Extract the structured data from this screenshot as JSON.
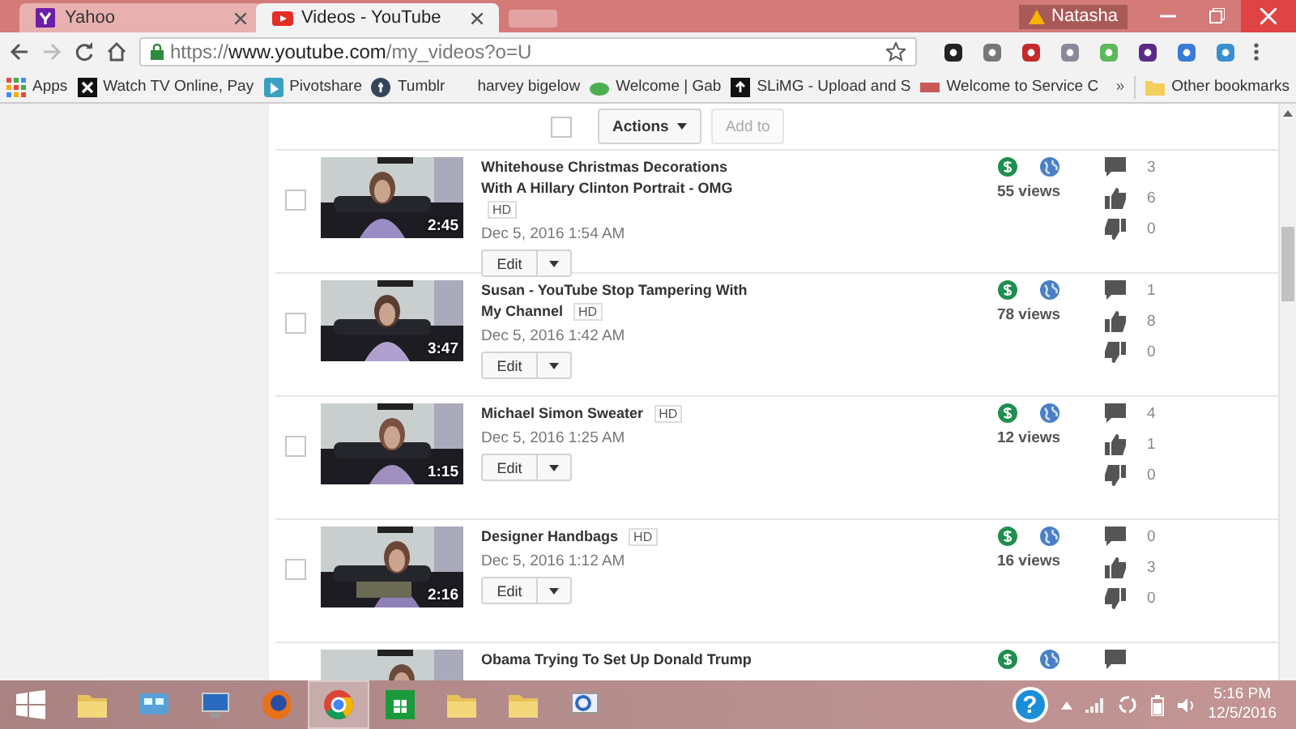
{
  "window": {
    "profile": "Natasha"
  },
  "tabs": [
    {
      "title": "Yahoo",
      "kind": "yahoo",
      "selected": false
    },
    {
      "title": "Videos - YouTube",
      "kind": "youtube",
      "selected": true
    }
  ],
  "address": {
    "scheme": "https://",
    "host": "www.youtube.com",
    "path": "/my_videos?o=U"
  },
  "bookmarks": [
    {
      "label": "Apps",
      "kind": "apps"
    },
    {
      "label": "Watch TV Online, Pay",
      "kind": "x"
    },
    {
      "label": "Pivotshare",
      "kind": "pivot"
    },
    {
      "label": "Tumblr",
      "kind": "tumblr"
    },
    {
      "label": "harvey bigelow",
      "kind": "none"
    },
    {
      "label": "Welcome | Gab",
      "kind": "frog"
    },
    {
      "label": "SLiMG - Upload and S",
      "kind": "upload"
    },
    {
      "label": "Welcome to Service C",
      "kind": "service"
    }
  ],
  "bookmarks_more": "»",
  "other_bookmarks": "Other bookmarks",
  "toolbar": {
    "select_all_checked": false,
    "actions": "Actions",
    "add_to": "Add to",
    "add_to_disabled": true
  },
  "videos": [
    {
      "checked": false,
      "title": "Whitehouse Christmas Decorations With A Hillary Clinton Portrait - OMG",
      "badge": "HD",
      "date": "Dec 5, 2016 1:54 AM",
      "duration": "2:45",
      "edit": "Edit",
      "views": "55 views",
      "comments": "3",
      "likes": "6",
      "dislikes": "0"
    },
    {
      "checked": false,
      "title": "Susan - YouTube Stop Tampering With My Channel",
      "badge": "HD",
      "date": "Dec 5, 2016 1:42 AM",
      "duration": "3:47",
      "edit": "Edit",
      "views": "78 views",
      "comments": "1",
      "likes": "8",
      "dislikes": "0"
    },
    {
      "checked": false,
      "title": "Michael Simon Sweater",
      "badge": "HD",
      "date": "Dec 5, 2016 1:25 AM",
      "duration": "1:15",
      "edit": "Edit",
      "views": "12 views",
      "comments": "4",
      "likes": "1",
      "dislikes": "0"
    },
    {
      "checked": false,
      "title": "Designer Handbags",
      "badge": "HD",
      "date": "Dec 5, 2016 1:12 AM",
      "duration": "2:16",
      "edit": "Edit",
      "views": "16 views",
      "comments": "0",
      "likes": "3",
      "dislikes": "0"
    },
    {
      "title": "Obama Trying To Set Up Donald Trump"
    }
  ],
  "taskbar": {
    "apps": [
      {
        "kind": "folder",
        "selected": false
      },
      {
        "kind": "control",
        "selected": false
      },
      {
        "kind": "monitor",
        "selected": false
      },
      {
        "kind": "firefox",
        "selected": false
      },
      {
        "kind": "chrome",
        "selected": true
      },
      {
        "kind": "store",
        "selected": false
      },
      {
        "kind": "folder",
        "selected": false
      },
      {
        "kind": "folder",
        "selected": false
      },
      {
        "kind": "search",
        "selected": false
      }
    ],
    "help": "?",
    "time": "5:16 PM",
    "date": "12/5/2016"
  }
}
